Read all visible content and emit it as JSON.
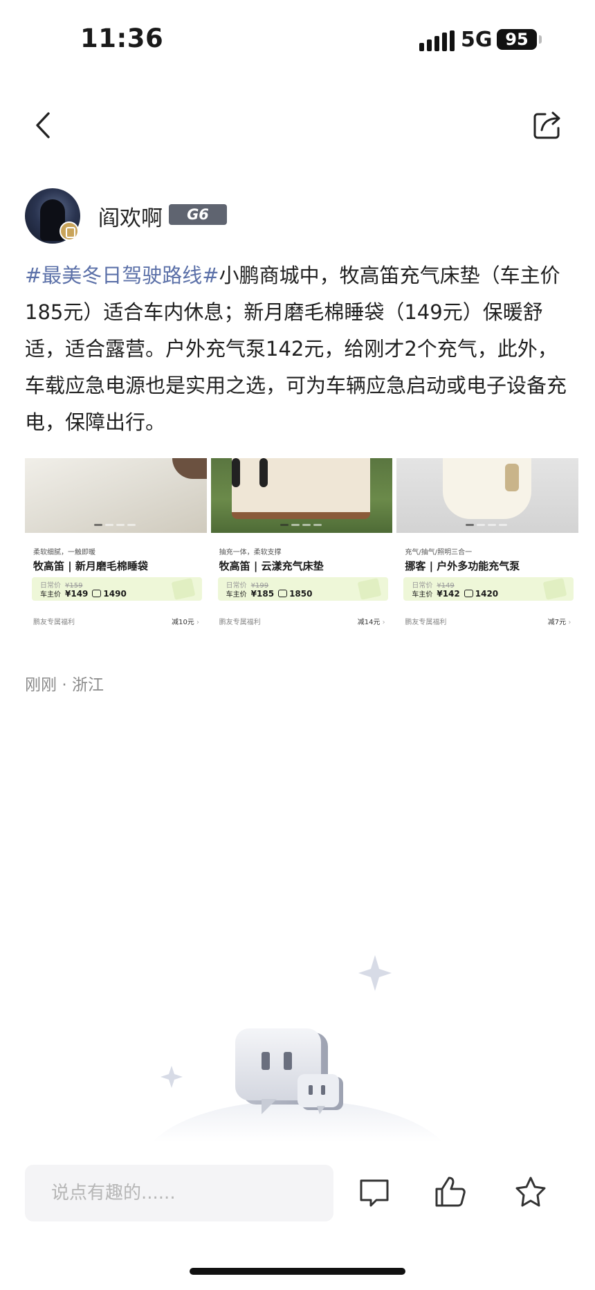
{
  "status_bar": {
    "time": "11:36",
    "network": "5G",
    "battery": "95"
  },
  "nav": {
    "back_icon": "chevron-left-icon",
    "share_icon": "share-icon"
  },
  "author": {
    "name": "阎欢啊",
    "level": "G6"
  },
  "post": {
    "hashtag": "#最美冬日驾驶路线#",
    "body": "小鹏商城中，牧高笛充气床垫（车主价185元）适合车内休息；新月磨毛棉睡袋（149元）保暖舒适，适合露营。户外充气泵142元，给刚才2个充气，此外，车载应急电源也是实用之选，可为车辆应急启动或电子设备充电，保障出行。"
  },
  "products": [
    {
      "tag": "柔软细腻，一触即暖",
      "title": "牧高笛 | 新月磨毛棉睡袋",
      "regular_label": "日常价",
      "regular_price": "¥159",
      "owner_label": "车主价",
      "owner_price": "¥149",
      "points": "1490",
      "perk_label": "鹏友专属福利",
      "perk_discount": "减10元"
    },
    {
      "tag": "抽充一体，柔软支撑",
      "title": "牧高笛 | 云漾充气床垫",
      "regular_label": "日常价",
      "regular_price": "¥199",
      "owner_label": "车主价",
      "owner_price": "¥185",
      "points": "1850",
      "perk_label": "鹏友专属福利",
      "perk_discount": "减14元"
    },
    {
      "tag": "充气/抽气/照明三合一",
      "title": "挪客 | 户外多功能充气泵",
      "regular_label": "日常价",
      "regular_price": "¥149",
      "owner_label": "车主价",
      "owner_price": "¥142",
      "points": "1420",
      "perk_label": "鹏友专属福利",
      "perk_discount": "减7元"
    }
  ],
  "meta": {
    "time": "刚刚",
    "separator": "·",
    "location": "浙江"
  },
  "bottom_bar": {
    "comment_placeholder": "说点有趣的......",
    "icons": [
      "comment-icon",
      "like-icon",
      "favorite-icon"
    ]
  }
}
